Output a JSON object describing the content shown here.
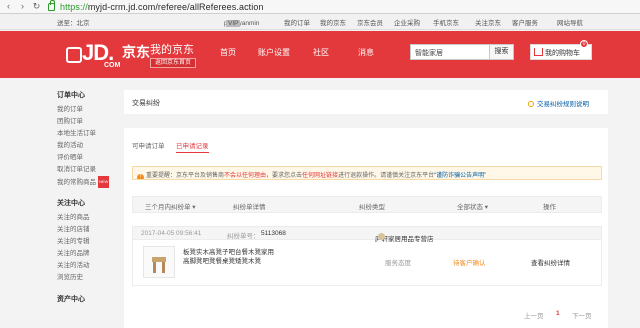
{
  "browser": {
    "url_scheme": "https://",
    "url_rest": "myjd-crm.jd.com/referee/allReferees.action"
  },
  "topbar": {
    "greeting": "送至：北京",
    "username": "pengyanmin",
    "vip": "VIP",
    "links": [
      "我的订单",
      "我的京东",
      "京东会员",
      "企业采购",
      "手机京东",
      "关注京东",
      "客户服务",
      "网站导航"
    ]
  },
  "header": {
    "logo_jd": "JD.",
    "logo_cn": "京东",
    "logo_com": "COM",
    "myjd_title": "我的京东",
    "home_button": "返回京东首页",
    "nav": [
      "首页",
      "账户设置",
      "社区",
      "消息"
    ],
    "search_value": "智能家居",
    "search_button": "搜索",
    "cart_label": "我的购物车",
    "cart_count": "0"
  },
  "sidebar": {
    "groups": [
      {
        "title": "订单中心",
        "items": [
          "我的订单",
          "团购订单",
          "本地生活订单",
          "我的活动",
          "评价晒单",
          "取消订单记录",
          "我的常购商品"
        ]
      },
      {
        "title": "关注中心",
        "items": [
          "关注的商品",
          "关注的店铺",
          "关注的专辑",
          "关注的品牌",
          "关注的活动",
          "浏览历史"
        ]
      },
      {
        "title": "资产中心",
        "items": []
      }
    ],
    "hot_badge": "NEW"
  },
  "page": {
    "title": "交易纠纷",
    "help_link": "交易纠纷规则说明",
    "tabs": [
      "可申请订单",
      "已申请记录"
    ],
    "notice_prefix": "重要提醒：京东平台及销售商",
    "notice_red": "不会以任何理由",
    "notice_mid": "，要求您点击",
    "notice_red2": "任何网址链接",
    "notice_suffix": "进行退款操作。请谨慎关注京东平台",
    "notice_link": "“谨防诈骗公告声明”"
  },
  "table": {
    "headers": [
      "三个月内纠纷单",
      "纠纷单详情",
      "纠纷类型",
      "全部状态",
      "操作"
    ],
    "row": {
      "datetime": "2017-04-05 09:56:41",
      "order_label": "纠纷单号：",
      "order_no": "5113068",
      "store": "庐轩家居用品专营店",
      "product": "板凳实木高凳子吧台餐木凳家用高脚凳吧凳餐桌凳矮凳木凳",
      "type": "服务态度",
      "status": "待客户确认",
      "action": "查看纠纷详情"
    }
  },
  "pager": {
    "prev": "上一页",
    "current": "1",
    "next": "下一页"
  },
  "colors": {
    "brand_red": "#e3393c",
    "link_blue": "#005ea7",
    "status_orange": "#f58b1f"
  }
}
